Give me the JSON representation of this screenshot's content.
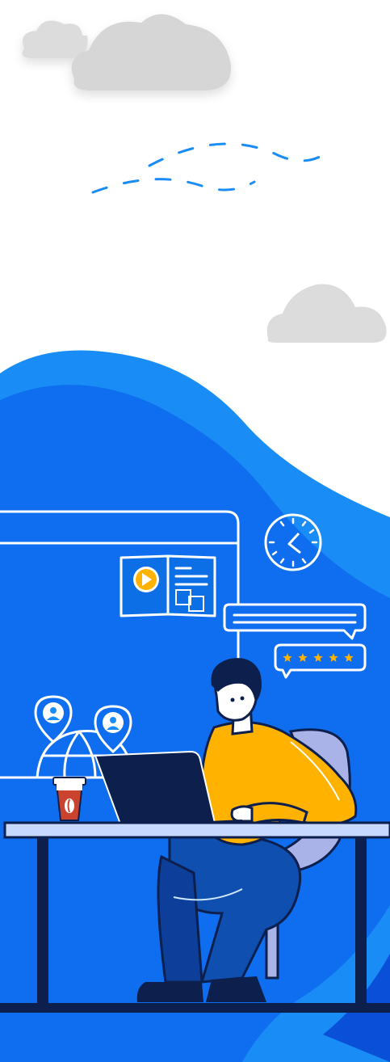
{
  "illustration": {
    "subject": "person-working-on-laptop",
    "colors": {
      "background": "#ffffff",
      "cloud": "#dcdcdc",
      "wave_light": "#1a8cf5",
      "wave_mid": "#0f6ef0",
      "wave_dark": "#0a4fd8",
      "navy": "#0d1f4c",
      "accent_orange": "#ffb300",
      "skin": "#ffffff",
      "cup": "#c9432f",
      "chair": "#a9b3e8",
      "outline_light": "#cfe6ff"
    },
    "rating_stars": 5,
    "icons": [
      "cloud-icon",
      "clock-icon",
      "book-translate-icon",
      "play-icon",
      "chat-bubble-icon",
      "rating-bubble-icon",
      "location-pin-icon",
      "globe-icon",
      "coffee-cup-icon",
      "laptop-icon"
    ]
  }
}
